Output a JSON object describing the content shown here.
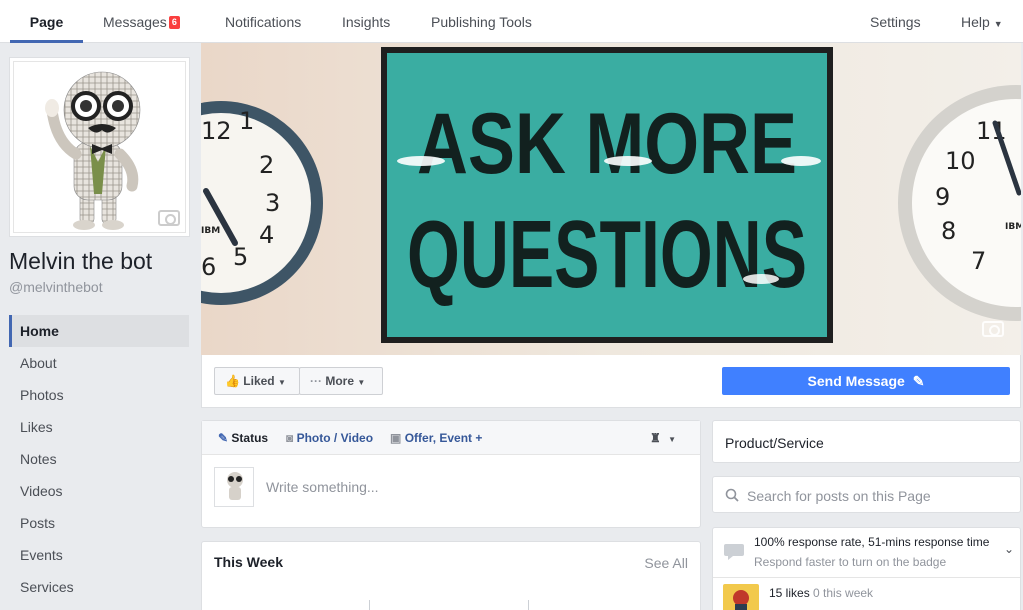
{
  "nav": {
    "tabs": [
      {
        "label": "Page"
      },
      {
        "label": "Messages",
        "badge": "6"
      },
      {
        "label": "Notifications"
      },
      {
        "label": "Insights"
      },
      {
        "label": "Publishing Tools"
      }
    ],
    "settings": "Settings",
    "help": "Help"
  },
  "profile": {
    "name": "Melvin the bot",
    "handle": "@melvinthebot"
  },
  "sidebar": {
    "items": [
      {
        "label": "Home"
      },
      {
        "label": "About"
      },
      {
        "label": "Photos"
      },
      {
        "label": "Likes"
      },
      {
        "label": "Notes"
      },
      {
        "label": "Videos"
      },
      {
        "label": "Posts"
      },
      {
        "label": "Events"
      },
      {
        "label": "Services"
      }
    ]
  },
  "cover": {
    "sign_line1": "ASK MORE",
    "sign_line2": "QUESTIONS",
    "clock_brand": "IBM",
    "clock_numbers_left": [
      "12",
      "1",
      "2",
      "3",
      "4",
      "5",
      "6"
    ],
    "clock_numbers_right": [
      "11",
      "10",
      "9",
      "8",
      "7"
    ]
  },
  "actions": {
    "liked": "Liked",
    "more": "More",
    "send_message": "Send Message"
  },
  "composer": {
    "status": "Status",
    "photo_video": "Photo / Video",
    "offer_event": "Offer, Event +",
    "placeholder": "Write something..."
  },
  "this_week": {
    "title": "This Week",
    "see_all": "See All"
  },
  "right": {
    "category": "Product/Service",
    "search_placeholder": "Search for posts on this Page",
    "response_rate": "100% response rate, 51-mins response time",
    "response_sub": "Respond faster to turn on the badge",
    "likes_count": "15 likes",
    "likes_week": "0 this week"
  },
  "colors": {
    "accent": "#4267b2",
    "send_button": "#4080ff",
    "badge": "#fa3e3e",
    "sign_teal": "#3aada2"
  }
}
